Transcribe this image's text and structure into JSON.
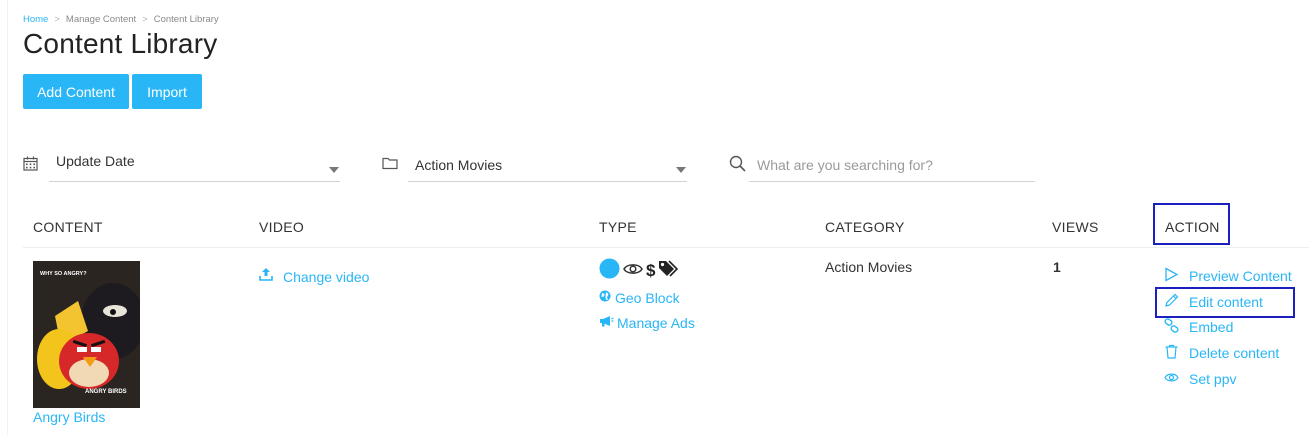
{
  "breadcrumb": {
    "home": "Home",
    "manage": "Manage Content",
    "library": "Content Library",
    "sep": ">"
  },
  "page": {
    "title": "Content Library"
  },
  "buttons": {
    "add": "Add Content",
    "import": "Import"
  },
  "filters": {
    "sort": {
      "value": "Update Date",
      "icon": "calendar-icon"
    },
    "category": {
      "value": "Action Movies",
      "icon": "folder-icon"
    },
    "search": {
      "placeholder": "What are you searching for?",
      "icon": "search-icon"
    }
  },
  "table": {
    "headers": [
      "CONTENT",
      "VIDEO",
      "TYPE",
      "CATEGORY",
      "VIEWS",
      "ACTION"
    ],
    "rows": [
      {
        "title": "Angry Birds",
        "poster_text": "WHY SO ANGRY?",
        "poster_title": "ANGRY BIRDS",
        "video_link": "Change video",
        "type_icons": [
          "status-dot-icon",
          "eye-icon",
          "dollar-icon",
          "tags-icon"
        ],
        "type_dollar": "$",
        "geo_block": "Geo Block",
        "manage_ads": "Manage Ads",
        "category": "Action Movies",
        "views": "1",
        "actions": [
          "Preview Content",
          "Edit content",
          "Embed",
          "Delete content",
          "Set ppv"
        ]
      }
    ]
  },
  "colors": {
    "accent": "#29b6f6",
    "highlight": "#1c1fbf",
    "text": "#333333"
  }
}
